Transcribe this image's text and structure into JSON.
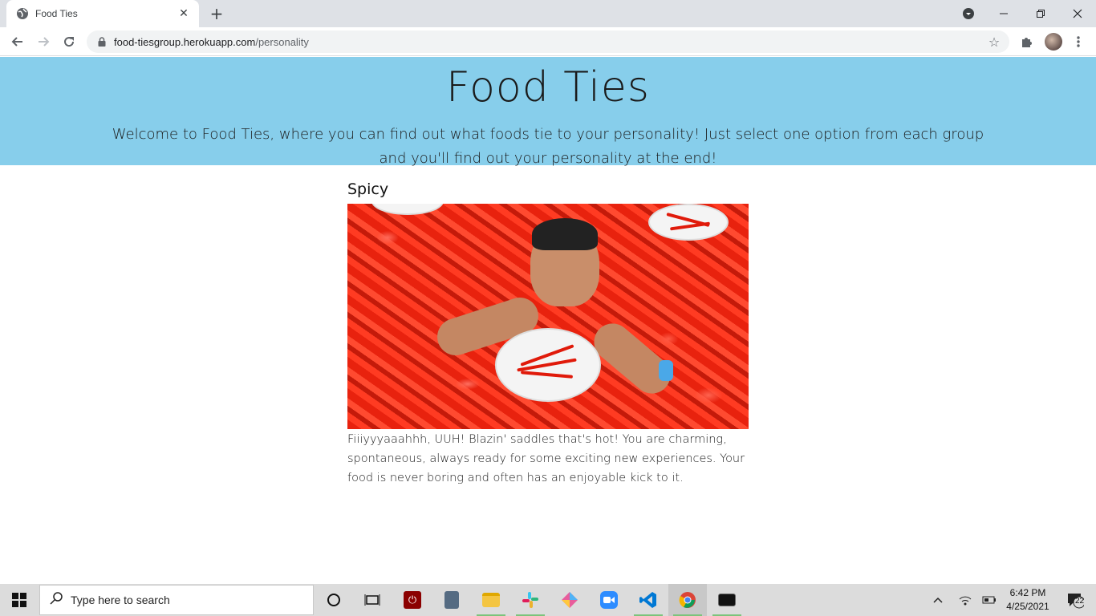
{
  "browser": {
    "tab_title": "Food Ties",
    "url_host": "food-tiesgroup.herokuapp.com",
    "url_path": "/personality"
  },
  "page": {
    "title": "Food Ties",
    "intro": "Welcome to Food Ties, where you can find out what foods tie to your personality! Just select one option from each group and you'll find out your personality at the end!",
    "result": {
      "heading": "Spicy",
      "description": "Fiiiyyyaaahhh, UUH! Blazin' saddles that's hot! You are charming, spontaneous, always ready for some exciting new experiences. Your food is never boring and often has an enjoyable kick to it."
    }
  },
  "taskbar": {
    "search_placeholder": "Type here to search",
    "time": "6:42 PM",
    "date": "4/25/2021",
    "notification_count": "22"
  },
  "colors": {
    "hero_bg": "#87ceeb",
    "tabbar_bg": "#dee1e6",
    "taskbar_bg": "#dcdcdc"
  }
}
